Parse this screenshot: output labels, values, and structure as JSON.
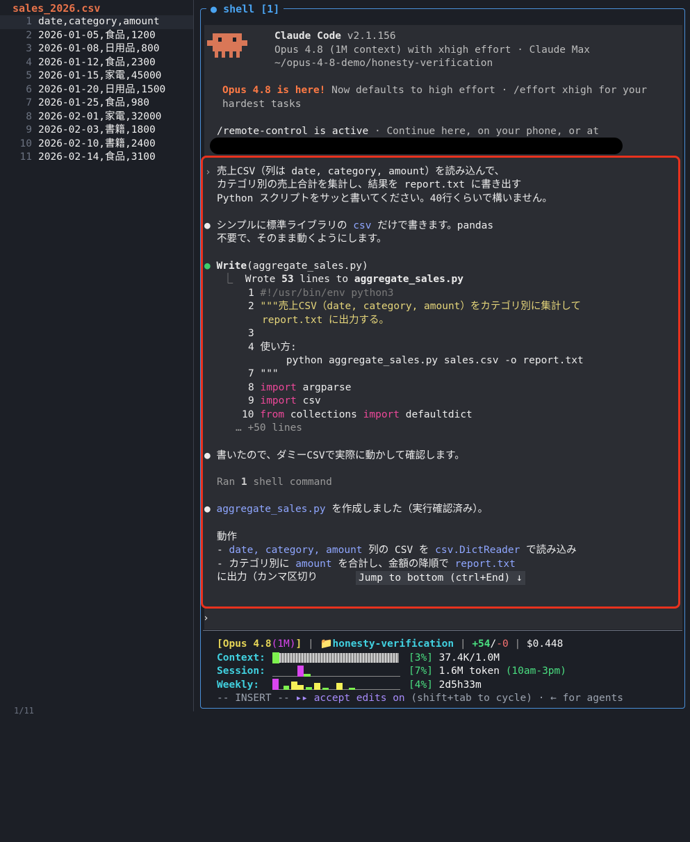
{
  "editor": {
    "file_tab": "sales_2026.csv",
    "lines": [
      {
        "n": "1",
        "text": "date,category,amount"
      },
      {
        "n": "2",
        "text": "2026-01-05,食品,1200"
      },
      {
        "n": "3",
        "text": "2026-01-08,日用品,800"
      },
      {
        "n": "4",
        "text": "2026-01-12,食品,2300"
      },
      {
        "n": "5",
        "text": "2026-01-15,家電,45000"
      },
      {
        "n": "6",
        "text": "2026-01-20,日用品,1500"
      },
      {
        "n": "7",
        "text": "2026-01-25,食品,980"
      },
      {
        "n": "8",
        "text": "2026-02-01,家電,32000"
      },
      {
        "n": "9",
        "text": "2026-02-03,書籍,1800"
      },
      {
        "n": "10",
        "text": "2026-02-10,書籍,2400"
      },
      {
        "n": "11",
        "text": "2026-02-14,食品,3100"
      }
    ],
    "status": "1/11"
  },
  "shell": {
    "title": "shell [1]",
    "app_name": "Claude Code",
    "version": "v2.1.156",
    "model_line": "Opus 4.8 (1M context) with xhigh effort · Claude Max",
    "path": "~/opus-4-8-demo/honesty-verification",
    "announce_highlight": "Opus 4.8 is here!",
    "announce_text": " Now defaults to high effort · /effort xhigh for your hardest tasks",
    "remote_cmd": "/remote-control is active",
    "remote_text": " · Continue here, on your phone, or at",
    "user_msg": [
      "売上CSV（列は date, category, amount）を読み込んで、",
      "カテゴリ別の売上合計を集計し、結果を report.txt に書き出す",
      "Python スクリプトをサッと書いてください。40行くらいで構いません。"
    ],
    "reply1_a": "シンプルに標準ライブラリの ",
    "reply1_code": "csv",
    "reply1_b": " だけで書きます。pandas",
    "reply1_line2": "不要で、そのまま動くようにします。",
    "write_tool": "Write",
    "write_arg": "(aggregate_sales.py)",
    "wrote_prefix": "Wrote ",
    "wrote_count": "53",
    "wrote_mid": " lines to ",
    "wrote_file": "aggregate_sales.py",
    "code": {
      "l1": "#!/usr/bin/env python3",
      "l2": "\"\"\"売上CSV（date, category, amount）をカテゴリ別に集計して",
      "l2b": "report.txt に出力する。",
      "l4": "使い方:",
      "l5": "    python aggregate_sales.py sales.csv -o report.txt",
      "l6": "\"\"\"",
      "kw_import": "import",
      "kw_from": "from",
      "argparse": " argparse",
      "csv": " csv",
      "collections": " collections ",
      "defaultdict": " defaultdict"
    },
    "more_lines": "… +50 lines",
    "reply2": "書いたので、ダミーCSVで実際に動かして確認します。",
    "ran_prefix": "Ran ",
    "ran_count": "1",
    "ran_suffix": " shell command",
    "reply3_file": "aggregate_sales.py",
    "reply3_text": " を作成しました（実行確認済み）。",
    "behavior_title": "動作",
    "b1_dash": "- ",
    "b1_cols": "date, category, amount",
    "b1_mid": " 列の CSV を ",
    "b1_code": "csv.DictReader",
    "b1_end": " で読み込み",
    "b2_a": "- カテゴリ別に ",
    "b2_code": "amount",
    "b2_b": " を合計し、金額の降順で ",
    "b2_file": "report.txt",
    "b3": "に出力（カンマ区切り",
    "jump_label": "Jump to bottom (ctrl+End) ↓",
    "prompt_char": "›"
  },
  "statusbar": {
    "model_open": "[Opus 4.8",
    "model_ctx": "(1M)",
    "model_close": "]",
    "sep": " | ",
    "folder_icon": "📁",
    "project": "honesty-verification",
    "diff_add": "+54",
    "diff_sep": "/",
    "diff_del": "-0",
    "cost": "$0.448",
    "context_label": "Context:",
    "context_pct": "[3%]",
    "context_value": "37.4K/1.0M",
    "session_label": "Session:",
    "session_pct": "[7%]",
    "session_value": "1.6M token",
    "session_window": "(10am-3pm)",
    "weekly_label": "Weekly:",
    "weekly_pct": "[4%]",
    "weekly_value": "2d5h33m",
    "mode_insert": "-- INSERT --",
    "mode_arrows": "▸▸",
    "mode_accept": "accept edits on",
    "mode_hint": " (shift+tab to cycle) · ← for agents"
  },
  "colors": {
    "accent_orange": "#e8734a",
    "highlight_red": "#e8321e",
    "shell_blue": "#4a90d9"
  }
}
